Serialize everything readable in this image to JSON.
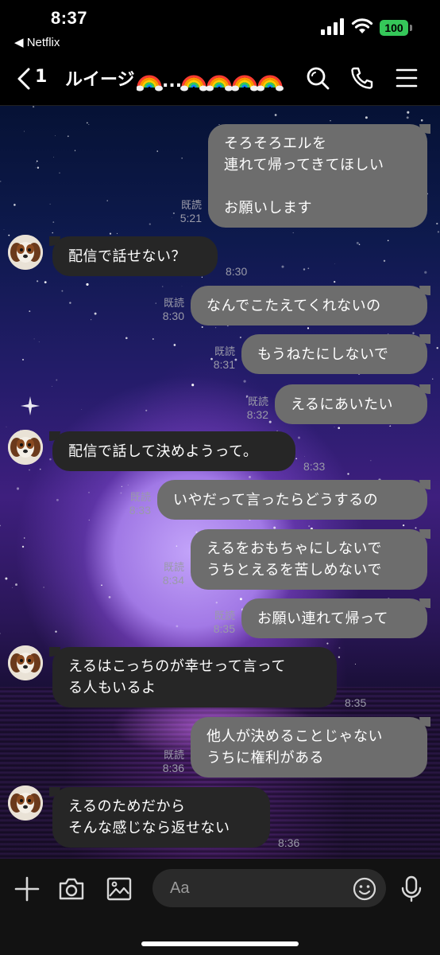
{
  "status_bar": {
    "time": "8:37",
    "back_app": "◀ Netflix",
    "battery": "100"
  },
  "header": {
    "back_count": "1",
    "title": "ルイージ",
    "title_ellipsis": "...",
    "icons": [
      "search-icon",
      "phone-icon",
      "menu-icon"
    ]
  },
  "messages": [
    {
      "side": "out",
      "text": "そろそろエルを\n連れて帰ってきてほしい\n\nお願いします",
      "read": "既読",
      "time": "5:21"
    },
    {
      "side": "in",
      "text": "配信で話せない？",
      "time": "8:30"
    },
    {
      "side": "out",
      "text": "なんでこたえてくれないの",
      "read": "既読",
      "time": "8:30"
    },
    {
      "side": "out",
      "text": "もうねたにしないで",
      "read": "既読",
      "time": "8:31"
    },
    {
      "side": "out",
      "text": "えるにあいたい",
      "read": "既読",
      "time": "8:32"
    },
    {
      "side": "in",
      "text": "配信で話して決めようって。",
      "time": "8:33"
    },
    {
      "side": "out",
      "text": "いやだって言ったらどうするの",
      "read": "既読",
      "time": "8:33"
    },
    {
      "side": "out",
      "text": "えるをおもちゃにしないで\nうちとえるを苦しめないで",
      "read": "既読",
      "time": "8:34"
    },
    {
      "side": "out",
      "text": "お願い連れて帰って",
      "read": "既読",
      "time": "8:35"
    },
    {
      "side": "in",
      "text": "えるはこっちのが幸せって言って\nる人もいるよ",
      "time": "8:35"
    },
    {
      "side": "out",
      "text": "他人が決めることじゃない\nうちに権利がある",
      "read": "既読",
      "time": "8:36"
    },
    {
      "side": "in",
      "text": "えるのためだから\nそんな感じなら返せない",
      "time": "8:36"
    }
  ],
  "input_bar": {
    "placeholder": "Aa",
    "icons": [
      "plus-icon",
      "camera-icon",
      "image-icon",
      "emoji-icon",
      "microphone-icon"
    ]
  }
}
